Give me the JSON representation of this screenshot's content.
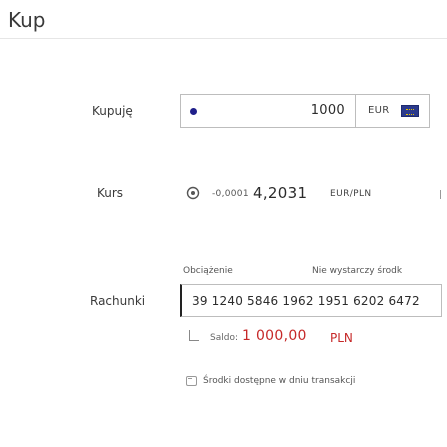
{
  "page": {
    "title": "Kup"
  },
  "buy": {
    "label": "Kupuję",
    "amount": "1000",
    "currency": "EUR",
    "currency_flag": "eu-flag-icon"
  },
  "rate": {
    "label": "Kurs",
    "change": "-0,0001",
    "value": "4,2031",
    "unit": "EUR/PLN",
    "icon": "refresh-icon"
  },
  "accounts": {
    "label": "Rachunki",
    "charge_label": "Obciążenie",
    "warning": "Nie wystarczy środk",
    "account_number": "39 1240 5846 1962 1951 6202 6472",
    "balance_label": "Saldo:",
    "balance_value": "1 000,00",
    "balance_currency": "PLN",
    "info": "Środki dostępne w dniu transakcji"
  },
  "colors": {
    "negative": "#c62828",
    "flag": "#2b3a8c"
  }
}
